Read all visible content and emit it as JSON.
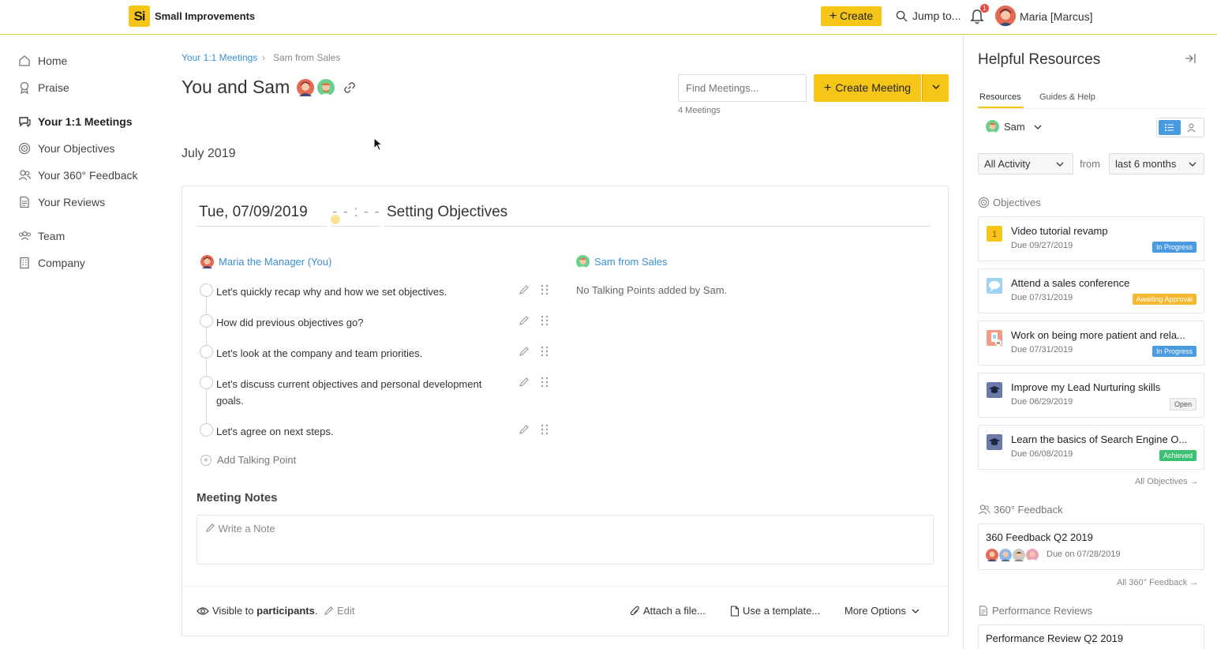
{
  "app": {
    "logo": "Si",
    "brand": "Small Improvements"
  },
  "topbar": {
    "create_label": "Create",
    "jump_label": "Jump to...",
    "notification_count": "1",
    "user_name": "Maria [Marcus]"
  },
  "sidebar": {
    "items": [
      {
        "label": "Home",
        "icon": "home-icon"
      },
      {
        "label": "Praise",
        "icon": "award-icon"
      },
      {
        "label": "Your 1:1 Meetings",
        "icon": "chat-icon"
      },
      {
        "label": "Your Objectives",
        "icon": "target-icon"
      },
      {
        "label": "Your 360° Feedback",
        "icon": "users-icon"
      },
      {
        "label": "Your Reviews",
        "icon": "document-icon"
      },
      {
        "label": "Team",
        "icon": "team-icon"
      },
      {
        "label": "Company",
        "icon": "building-icon"
      }
    ]
  },
  "breadcrumb": {
    "parent": "Your 1:1 Meetings",
    "current": "Sam from Sales"
  },
  "page": {
    "title": "You and Sam",
    "find_placeholder": "Find Meetings...",
    "meetings_count": "4 Meetings",
    "create_meeting_label": "Create Meeting",
    "month": "July 2019"
  },
  "meeting": {
    "date": "Tue, 07/09/2019",
    "time": "- - : - -",
    "topic": "Setting Objectives",
    "manager_name": "Maria the Manager (You)",
    "report_name": "Sam from Sales",
    "no_points_text": "No Talking Points added by Sam.",
    "talking_points": [
      "Let's quickly recap why and how we set objectives.",
      "How did previous objectives go?",
      "Let's look at the company and team priorities.",
      "Let's discuss current objectives and personal development goals.",
      "Let's agree on next steps."
    ],
    "add_point_label": "Add Talking Point",
    "notes_title": "Meeting Notes",
    "notes_placeholder": "Write a Note",
    "visibility_prefix": "Visible to",
    "visibility_target": "participants",
    "visibility_suffix": ".",
    "edit_label": "Edit",
    "attach_label": "Attach a file...",
    "template_label": "Use a template...",
    "more_options_label": "More Options"
  },
  "resources": {
    "title": "Helpful Resources",
    "tabs": [
      "Resources",
      "Guides & Help"
    ],
    "person": "Sam",
    "activity_filter": "All Activity",
    "from_label": "from",
    "range_filter": "last 6 months",
    "objectives_title": "Objectives",
    "objectives": [
      {
        "title": "Video tutorial revamp",
        "due": "Due 09/27/2019",
        "status": "In Progress",
        "status_color": "#4a9ae0",
        "icon_color": "#f5c518"
      },
      {
        "title": "Attend a sales conference",
        "due": "Due 07/31/2019",
        "status": "Awaiting Approval",
        "status_color": "#f5b82e",
        "icon_color": "#9fd3f0"
      },
      {
        "title": "Work on being more patient and rela...",
        "due": "Due 07/31/2019",
        "status": "In Progress",
        "status_color": "#4a9ae0",
        "icon_color": "#f29a8a"
      },
      {
        "title": "Improve my Lead Nurturing skills",
        "due": "Due 06/29/2019",
        "status": "Open",
        "status_color": "#f2f2f2",
        "icon_color": "#6c7aa8"
      },
      {
        "title": "Learn the basics of Search Engine O...",
        "due": "Due 06/08/2019",
        "status": "Achieved",
        "status_color": "#3cc073",
        "icon_color": "#6c7aa8"
      }
    ],
    "all_objectives_link": "All Objectives →",
    "feedback_title": "360° Feedback",
    "feedback_card_title": "360 Feedback Q2 2019",
    "feedback_due": "Due on 07/28/2019",
    "all_feedback_link": "All 360° Feedback →",
    "reviews_title": "Performance Reviews",
    "review_card_title": "Performance Review Q2 2019"
  }
}
